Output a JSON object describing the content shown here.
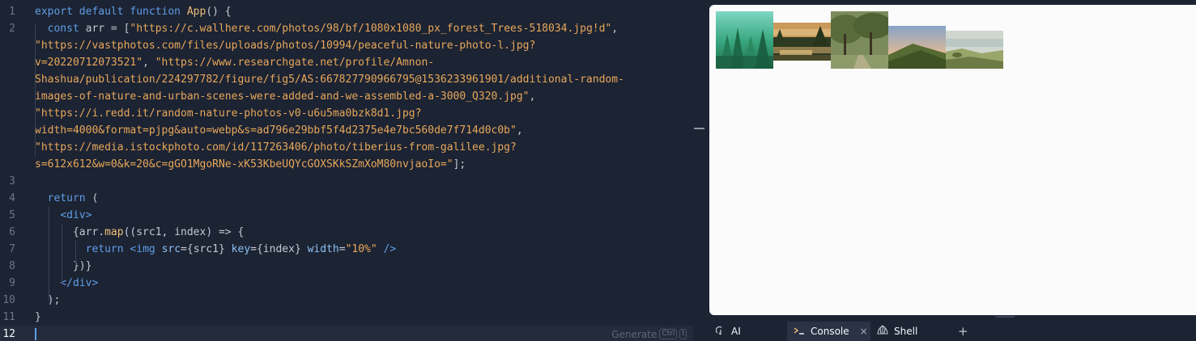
{
  "editor": {
    "lines": [
      {
        "n": "1",
        "tokens": [
          [
            "kw",
            "export default function "
          ],
          [
            "fn",
            "App"
          ],
          [
            "pl",
            "() {"
          ]
        ]
      },
      {
        "n": "2",
        "tokens": [
          [
            "pl",
            "  "
          ],
          [
            "kw",
            "const "
          ],
          [
            "pl",
            "arr = ["
          ],
          [
            "str",
            "\"https://c.wallhere.com/photos/98/bf/1080x1080_px_forest_Trees-518034.jpg!d\""
          ],
          [
            "pl",
            ","
          ]
        ]
      },
      {
        "n": "",
        "tokens": [
          [
            "str",
            "\"https://vastphotos.com/files/uploads/photos/10994/peaceful-nature-photo-l.jpg?"
          ]
        ]
      },
      {
        "n": "",
        "tokens": [
          [
            "str",
            "v=20220712073521\""
          ],
          [
            "pl",
            ", "
          ],
          [
            "str",
            "\"https://www.researchgate.net/profile/Amnon-"
          ]
        ]
      },
      {
        "n": "",
        "tokens": [
          [
            "str",
            "Shashua/publication/224297782/figure/fig5/AS:667827790966795@1536233961901/additional-random-"
          ]
        ]
      },
      {
        "n": "",
        "tokens": [
          [
            "str",
            "images-of-nature-and-urban-scenes-were-added-and-we-assembled-a-3000_Q320.jpg\""
          ],
          [
            "pl",
            ","
          ]
        ]
      },
      {
        "n": "",
        "tokens": [
          [
            "str",
            "\"https://i.redd.it/random-nature-photos-v0-u6u5ma0bzk8d1.jpg?"
          ]
        ]
      },
      {
        "n": "",
        "tokens": [
          [
            "str",
            "width=4000&format=pjpg&auto=webp&s=ad796e29bbf5f4d2375e4e7bc560de7f714d0c0b\""
          ],
          [
            "pl",
            ","
          ]
        ]
      },
      {
        "n": "",
        "tokens": [
          [
            "str",
            "\"https://media.istockphoto.com/id/117263406/photo/tiberius-from-galilee.jpg?"
          ]
        ]
      },
      {
        "n": "",
        "tokens": [
          [
            "str",
            "s=612x612&w=0&k=20&c=gGO1MgoRNe-xK53KbeUQYcGOXSKkSZmXoM80nvjaoIo=\""
          ],
          [
            "pl",
            "];"
          ]
        ]
      },
      {
        "n": "3",
        "tokens": []
      },
      {
        "n": "4",
        "tokens": [
          [
            "pl",
            "  "
          ],
          [
            "kw",
            "return "
          ],
          [
            "pl",
            "("
          ]
        ]
      },
      {
        "n": "5",
        "tokens": [
          [
            "pl",
            "    "
          ],
          [
            "tag",
            "<div>"
          ]
        ]
      },
      {
        "n": "6",
        "tokens": [
          [
            "pl",
            "      {arr."
          ],
          [
            "fn",
            "map"
          ],
          [
            "pl",
            "((src1, index) => {"
          ]
        ]
      },
      {
        "n": "7",
        "tokens": [
          [
            "pl",
            "        "
          ],
          [
            "kw",
            "return "
          ],
          [
            "tag",
            "<img "
          ],
          [
            "attr",
            "src"
          ],
          [
            "pl",
            "={src1} "
          ],
          [
            "attr",
            "key"
          ],
          [
            "pl",
            "={index} "
          ],
          [
            "attr",
            "width"
          ],
          [
            "pl",
            "="
          ],
          [
            "str",
            "\"10%\""
          ],
          [
            "tag",
            " />"
          ]
        ]
      },
      {
        "n": "8",
        "tokens": [
          [
            "pl",
            "      })}"
          ]
        ]
      },
      {
        "n": "9",
        "tokens": [
          [
            "pl",
            "    "
          ],
          [
            "tag",
            "</div>"
          ]
        ]
      },
      {
        "n": "10",
        "tokens": [
          [
            "pl",
            "  );"
          ]
        ]
      },
      {
        "n": "11",
        "tokens": [
          [
            "pl",
            "}"
          ]
        ]
      },
      {
        "n": "12",
        "tokens": []
      }
    ],
    "generate_label": "Generate",
    "shortcut_key1": "Ctrl",
    "shortcut_key2": "I"
  },
  "tabs": {
    "ai": {
      "label": "AI",
      "icon": "ai-icon"
    },
    "console": {
      "label": "Console",
      "icon": "terminal-icon",
      "close": "×"
    },
    "shell": {
      "label": "Shell",
      "icon": "shell-icon"
    },
    "add": "+"
  },
  "colors": {
    "editor_bg": "#1c2333",
    "keyword": "#5f9ee6",
    "string": "#e8a85a",
    "function": "#f0c17a",
    "preview_bg": "#fbfbfc"
  }
}
